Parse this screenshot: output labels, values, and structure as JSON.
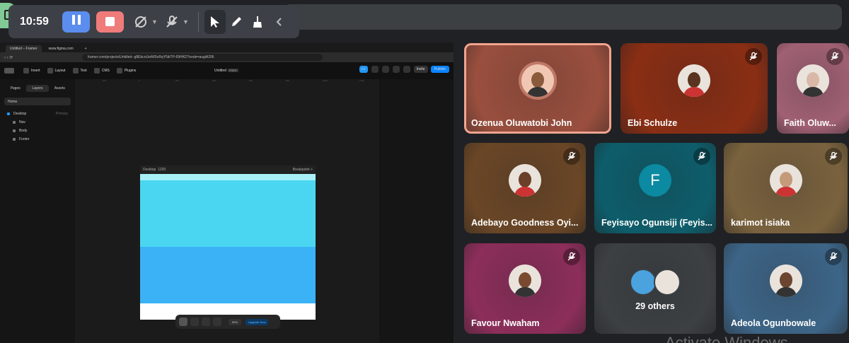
{
  "recorder": {
    "time": "10:59",
    "colors": {
      "pause": "#5b8def",
      "stop": "#f07b7b"
    },
    "icons": [
      "pause-icon",
      "stop-icon",
      "camera-off-icon",
      "mic-off-icon",
      "cursor-icon",
      "pen-icon",
      "broom-icon",
      "chevron-left-icon"
    ]
  },
  "shared_screen": {
    "browser": {
      "tabs": [
        "Untitled – Framer",
        "www.figma.com",
        "+"
      ],
      "url": "framer.com/projects/Untitled--g8EbcnUeiW5oRqY5ikTP-69HKD?node=augiA20II"
    },
    "framer": {
      "tools": [
        "Insert",
        "Layout",
        "Text",
        "CMS",
        "Plugins"
      ],
      "title": "Untitled",
      "plan_badge": "FREE",
      "fs_label": "FS",
      "invite_label": "Invite",
      "publish_label": "Publish",
      "panel_tabs": [
        "Pages",
        "Layers",
        "Assets"
      ],
      "page_select": "Home",
      "layers": [
        {
          "label": "Desktop",
          "sub": "Primary"
        },
        {
          "label": "Nav",
          "sub": ""
        },
        {
          "label": "Body",
          "sub": ""
        },
        {
          "label": "Footer",
          "sub": ""
        }
      ],
      "ruler": [
        "-200",
        "0",
        "200",
        "400",
        "600",
        "800",
        "1000",
        "1200",
        "1400"
      ],
      "frame_label": "Desktop",
      "frame_width": "1200",
      "breakpoint_label": "Breakpoint",
      "zoom": "50%",
      "upgrade_label": "Upgrade Now",
      "section_colors": [
        "#a8f0f8",
        "#4ad6f1",
        "#3bb2f5",
        "#ffffff"
      ]
    }
  },
  "participants": [
    {
      "name": "Ozenua Oluwatobi John",
      "muted": false,
      "speaking": true,
      "avatar": "photo",
      "bg": "#9a4f3e"
    },
    {
      "name": "Ebi Schulze",
      "muted": true,
      "avatar": "photo",
      "bg": "#8a2e14"
    },
    {
      "name": "Faith Oluw...",
      "muted": true,
      "avatar": "photo",
      "bg": "#a06074"
    },
    {
      "name": "Adebayo Goodness Oyi...",
      "muted": true,
      "avatar": "photo",
      "bg": "#6a4626"
    },
    {
      "name": "Feyisayo Ogunsiji (Feyis...",
      "muted": true,
      "avatar": "initial",
      "initial": "F",
      "bg": "#0e5d6b"
    },
    {
      "name": "karimot isiaka",
      "muted": true,
      "avatar": "photo",
      "bg": "#7a623e"
    },
    {
      "name": "Favour Nwaham",
      "muted": true,
      "avatar": "photo",
      "bg": "#8c2e5a"
    },
    {
      "name": "29 others",
      "muted": false,
      "avatar": "group",
      "bg": "#3c4043"
    },
    {
      "name": "Adeola Ogunbowale",
      "muted": true,
      "avatar": "photo",
      "bg": "#3d6587"
    }
  ],
  "watermark": "Activate Windows"
}
